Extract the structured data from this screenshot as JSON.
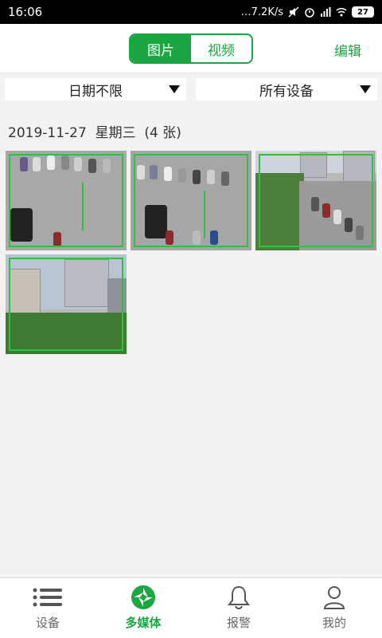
{
  "status_bar": {
    "time": "16:06",
    "network_speed": "…7.2K/s",
    "battery": "27"
  },
  "header": {
    "tabs": [
      {
        "label": "图片",
        "active": true
      },
      {
        "label": "视频",
        "active": false
      }
    ],
    "edit_label": "编辑"
  },
  "filters": {
    "date": "日期不限",
    "device": "所有设备"
  },
  "section": {
    "date": "2019-11-27",
    "weekday": "星期三",
    "count": "(4 张)"
  },
  "thumbnails": [
    {
      "scene": "parking-lot"
    },
    {
      "scene": "parking-lot"
    },
    {
      "scene": "street-trees"
    },
    {
      "scene": "buildings-trees"
    }
  ],
  "bottom_nav": [
    {
      "label": "设备",
      "icon": "list-icon",
      "active": false
    },
    {
      "label": "多媒体",
      "icon": "camera-shutter-icon",
      "active": true
    },
    {
      "label": "报警",
      "icon": "bell-icon",
      "active": false
    },
    {
      "label": "我的",
      "icon": "person-icon",
      "active": false
    }
  ],
  "colors": {
    "accent": "#1aa640",
    "frame": "#2fc144",
    "background": "#f2f2f2"
  }
}
